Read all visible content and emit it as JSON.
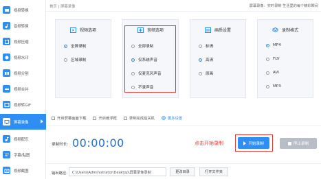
{
  "colors": {
    "accent": "#2f8ef4",
    "highlight": "#e53935",
    "time": "#1f6fd6",
    "disabled": "#b8bec7"
  },
  "sidebar": {
    "items": [
      {
        "label": "视频转换",
        "icon": "video-convert-icon",
        "active": false
      },
      {
        "label": "音频转换",
        "icon": "audio-convert-icon",
        "active": false
      },
      {
        "label": "视频压缩",
        "icon": "compress-icon",
        "active": false
      },
      {
        "label": "视频水印",
        "icon": "watermark-icon",
        "active": false
      },
      {
        "label": "视频分割",
        "icon": "split-icon",
        "active": false
      },
      {
        "label": "视频合并",
        "icon": "merge-icon",
        "active": false
      },
      {
        "label": "视频转GIF",
        "icon": "gif-icon",
        "active": false
      },
      {
        "label": "屏幕录像",
        "icon": "screen-record-icon",
        "active": true
      },
      {
        "label": "视频配乐",
        "icon": "music-icon",
        "active": false
      },
      {
        "label": "字幕/贴图",
        "icon": "subtitle-icon",
        "active": false
      },
      {
        "label": "视频截图",
        "icon": "screenshot-icon",
        "active": false
      }
    ]
  },
  "header": {
    "breadcrumb": "首页 | 屏幕录像",
    "tip": "屏幕录像：实时录制 生活里的每个精彩瞬间"
  },
  "panels": {
    "video": {
      "title": "视频选项",
      "icon": "video-icon",
      "options": [
        "全屏录制",
        "区域录制"
      ],
      "selected": 0
    },
    "audio": {
      "title": "音频选项",
      "icon": "audio-icon",
      "options": [
        "全部录制",
        "仅系统声音",
        "仅麦克风声音",
        "不录声音"
      ],
      "selected": 1
    },
    "quality": {
      "title": "画质设置",
      "icon": "quality-icon",
      "options": [
        "标清",
        "高清",
        "原画"
      ],
      "selected": 1
    },
    "format": {
      "title": "录制格式",
      "icon": "format-icon",
      "options": [
        "MP4",
        "FLV",
        "AVI",
        "MP3"
      ],
      "selected": 0
    }
  },
  "checks": {
    "items": [
      "开启屏幕画面下载",
      "开启悬浮框",
      "录制完成后关机"
    ],
    "advanced": "更多设置"
  },
  "record": {
    "time_label": "录制时长:",
    "time": "00:00:00",
    "hint": "点击开始录制",
    "start_label": "开始录制",
    "stop_label": "停止录制"
  },
  "footer": {
    "output_label": "输出路径:",
    "path": "C:\\Users\\Administrator\\Desktop\\屏幕录像录制",
    "change_label": "更改目录",
    "open_label": "打开文件夹"
  }
}
